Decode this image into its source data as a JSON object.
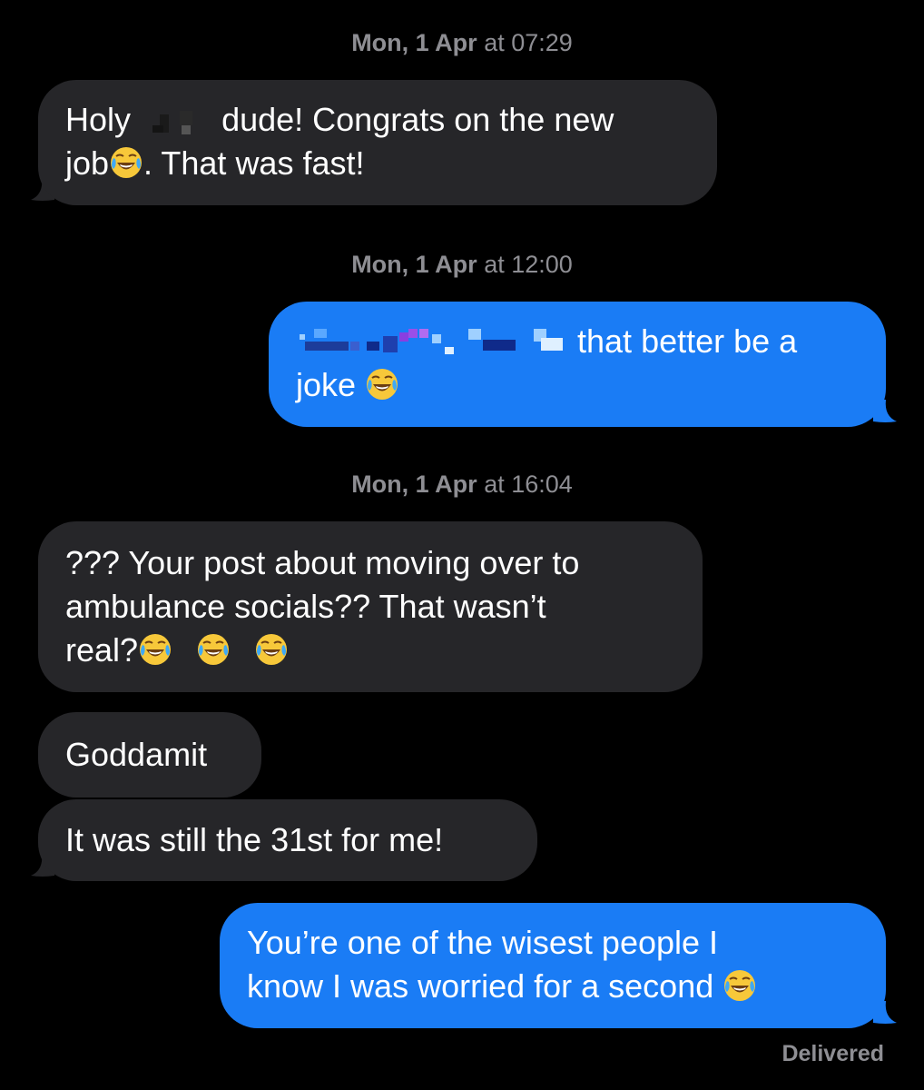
{
  "conversation": {
    "timestamps": [
      {
        "day": "Mon, 1 Apr",
        "sep": " at ",
        "time": "07:29"
      },
      {
        "day": "Mon, 1 Apr",
        "sep": " at ",
        "time": "12:00"
      },
      {
        "day": "Mon, 1 Apr",
        "sep": " at ",
        "time": "16:04"
      }
    ],
    "messages": [
      {
        "from": "them",
        "parts": [
          "Holy",
          "dude! Congrats on the new",
          "job",
          ". That was fast!"
        ]
      },
      {
        "from": "me",
        "parts": [
          "that better be a",
          "joke "
        ]
      },
      {
        "from": "them",
        "parts": [
          "??? Your post about moving over to",
          "ambulance socials?? That wasn’t",
          "real?"
        ]
      },
      {
        "from": "them",
        "parts": [
          "Goddamit"
        ]
      },
      {
        "from": "them",
        "parts": [
          "It was still the 31st for me!"
        ]
      },
      {
        "from": "me",
        "parts": [
          "You’re one of the wisest people I",
          "know I was worried for a second "
        ]
      }
    ],
    "status": "Delivered"
  },
  "icons": {
    "emoji": "face-with-tears-of-joy-icon",
    "redaction": "pixelated-redaction"
  },
  "colors": {
    "background": "#000000",
    "received_bubble": "#262629",
    "sent_bubble": "#1a7cf5",
    "timestamp_text": "#8e8e93"
  }
}
